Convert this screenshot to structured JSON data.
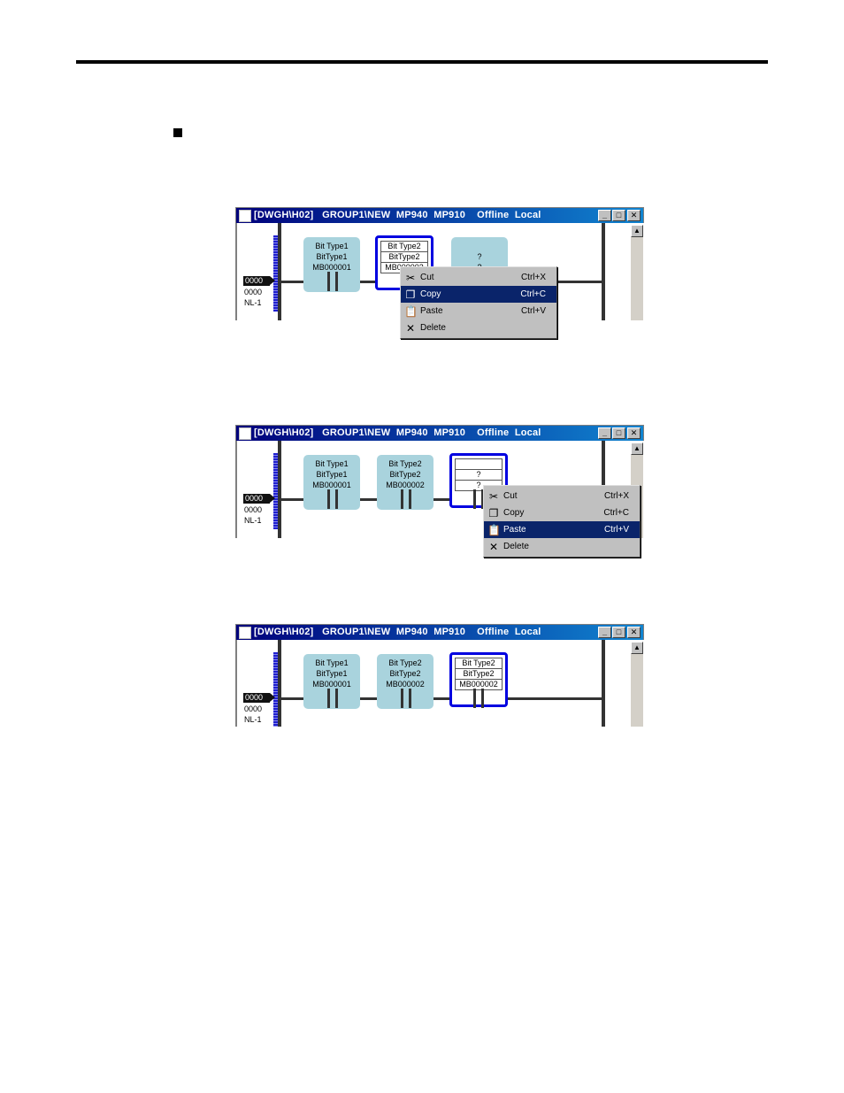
{
  "window": {
    "title": "[DWGH\\H02]   GROUP1\\NEW  MP940  MP910    Offline  Local",
    "buttons": {
      "minimize": "_",
      "maximize": "□",
      "close": "✕"
    }
  },
  "ladder": {
    "step_tag": "0000",
    "step_line2": "0000",
    "step_line3": "NL-1"
  },
  "panels": [
    {
      "cells": [
        {
          "lines": [
            "Bit Type1",
            "BitType1",
            "MB000001"
          ]
        },
        {
          "lines": [
            "Bit Type2",
            "BitType2",
            "MB000002"
          ]
        },
        {
          "lines": [
            "?",
            "?"
          ]
        }
      ],
      "menu": {
        "items": [
          {
            "label": "Cut",
            "shortcut": "Ctrl+X",
            "icon": "scissors-icon"
          },
          {
            "label": "Copy",
            "shortcut": "Ctrl+C",
            "icon": "copy-icon"
          },
          {
            "label": "Paste",
            "shortcut": "Ctrl+V",
            "icon": "paste-icon"
          },
          {
            "label": "Delete",
            "shortcut": "",
            "icon": "delete-x-icon"
          }
        ]
      }
    },
    {
      "cells": [
        {
          "lines": [
            "Bit Type1",
            "BitType1",
            "MB000001"
          ]
        },
        {
          "lines": [
            "Bit Type2",
            "BitType2",
            "MB000002"
          ]
        },
        {
          "lines": [
            "",
            "?",
            "?"
          ]
        }
      ],
      "menu": {
        "items": [
          {
            "label": "Cut",
            "shortcut": "Ctrl+X",
            "icon": "scissors-icon"
          },
          {
            "label": "Copy",
            "shortcut": "Ctrl+C",
            "icon": "copy-icon"
          },
          {
            "label": "Paste",
            "shortcut": "Ctrl+V",
            "icon": "paste-icon"
          },
          {
            "label": "Delete",
            "shortcut": "",
            "icon": "delete-x-icon"
          }
        ]
      }
    },
    {
      "cells": [
        {
          "lines": [
            "Bit Type1",
            "BitType1",
            "MB000001"
          ]
        },
        {
          "lines": [
            "Bit Type2",
            "BitType2",
            "MB000002"
          ]
        },
        {
          "lines": [
            "Bit Type2",
            "BitType2",
            "MB000002"
          ]
        }
      ]
    }
  ]
}
